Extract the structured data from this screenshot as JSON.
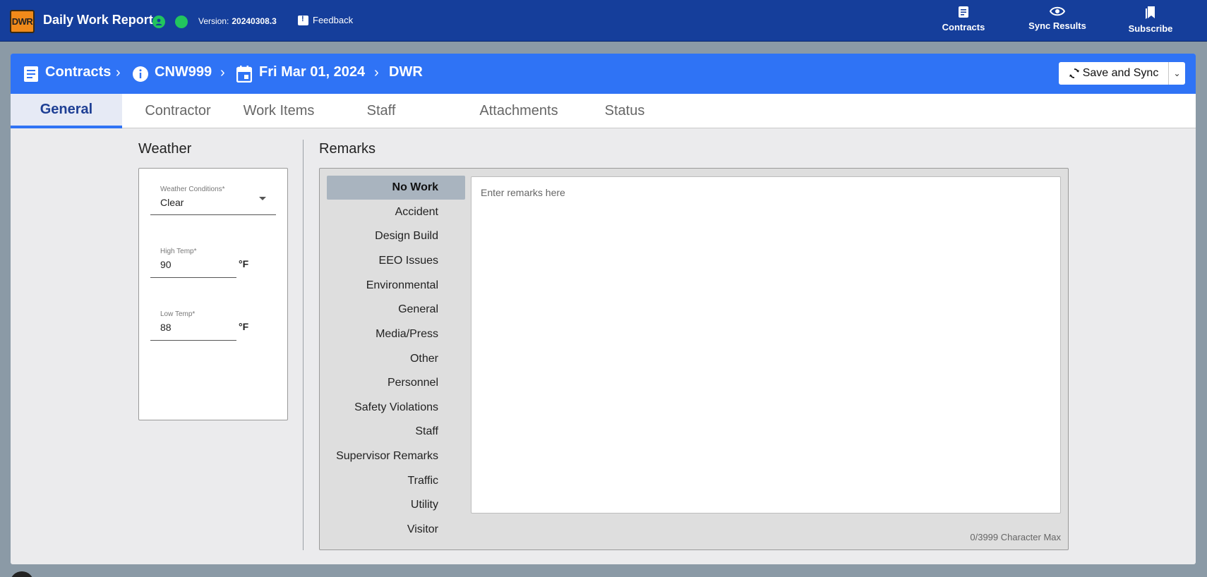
{
  "app": {
    "logo_text": "DWR",
    "title": "Daily Work Report",
    "version_label": "Version:",
    "version_number": "20240308.3",
    "feedback_label": "Feedback"
  },
  "nav": {
    "contracts": {
      "label": "Contracts",
      "icon": "document-icon"
    },
    "sync_results": {
      "label": "Sync Results",
      "icon": "eye-icon"
    },
    "subscribe": {
      "label": "Subscribe",
      "icon": "bookmarks-icon"
    }
  },
  "breadcrumb": {
    "contracts": "Contracts",
    "contract_id": "CNW999",
    "date": "Fri Mar 01, 2024",
    "page": "DWR"
  },
  "save_button": {
    "label": "Save and Sync"
  },
  "tabs": [
    "General",
    "Contractor",
    "Work Items",
    "Staff",
    "Attachments",
    "Status"
  ],
  "active_tab": "General",
  "weather": {
    "title": "Weather",
    "conditions": {
      "label": "Weather Conditions*",
      "value": "Clear"
    },
    "high_temp": {
      "label": "High Temp*",
      "value": "90",
      "unit": "°F"
    },
    "low_temp": {
      "label": "Low Temp*",
      "value": "88",
      "unit": "°F"
    }
  },
  "remarks": {
    "title": "Remarks",
    "categories": [
      "No Work",
      "Accident",
      "Design Build",
      "EEO Issues",
      "Environmental",
      "General",
      "Media/Press",
      "Other",
      "Personnel",
      "Safety Violations",
      "Staff",
      "Supervisor Remarks",
      "Traffic",
      "Utility",
      "Visitor"
    ],
    "active_category": "No Work",
    "placeholder": "Enter remarks here",
    "char_count": "0/3999 Character Max"
  },
  "colors": {
    "appbar": "#153e9b",
    "breadcrumb_bar": "#2f73f5",
    "status_green": "#22c55e",
    "logo_orange": "#f08a1a"
  }
}
